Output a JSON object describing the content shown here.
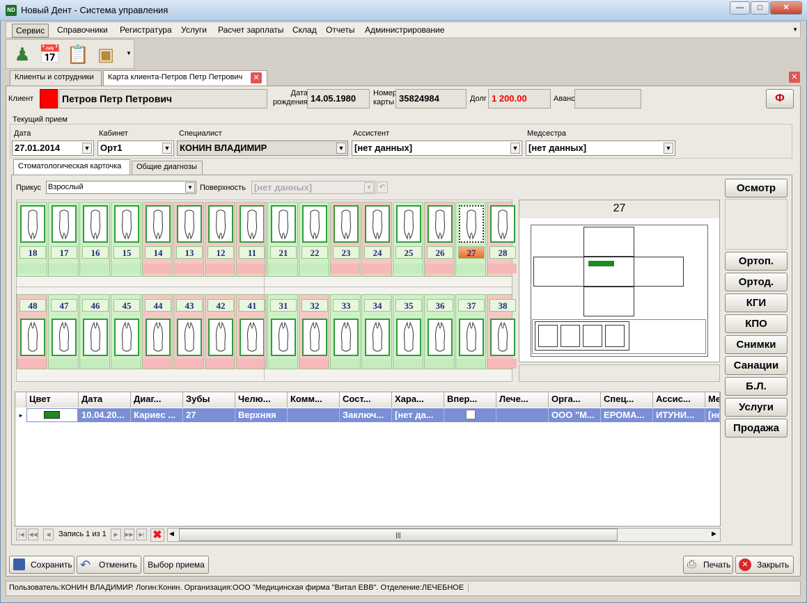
{
  "window": {
    "title": "Новый Дент - Система управления",
    "icon": "ND"
  },
  "menu": [
    "Сервис",
    "Справочники",
    "Регистратура",
    "Услуги",
    "Расчет зарплаты",
    "Склад",
    "Отчеты",
    "Администрирование"
  ],
  "toolbar": [
    "user-icon",
    "calendar-icon",
    "clipboard-icon",
    "box-icon"
  ],
  "tabs": [
    "Клиенты и сотрудники",
    "Карта клиента-Петров Петр Петрович"
  ],
  "client": {
    "label": "Клиент",
    "name": "Петров Петр Петрович",
    "dob_label": "Дата рождения",
    "dob": "14.05.1980",
    "card_label": "Номер карты",
    "card": "35824984",
    "debt_label": "Долг",
    "debt": "1 200.00",
    "advance_label": "Аванс",
    "advance": "",
    "f_button": "Ф"
  },
  "visit": {
    "section": "Текущий прием",
    "date_label": "Дата",
    "date": "27.01.2014",
    "cabinet_label": "Кабинет",
    "cabinet": "Орт1",
    "specialist_label": "Специалист",
    "specialist": "КОНИН ВЛАДИМИР",
    "assistant_label": "Ассистент",
    "assistant": "[нет данных]",
    "nurse_label": "Медсестра",
    "nurse": "[нет данных]"
  },
  "subtabs": [
    "Стоматологическая карточка",
    "Общие диагнозы"
  ],
  "bite": {
    "label": "Прикус",
    "value": "Взрослый",
    "surface_label": "Поверхность",
    "surface_value": "[нет данных]"
  },
  "teeth_upper": [
    {
      "n": "18",
      "c": "g"
    },
    {
      "n": "17",
      "c": "g"
    },
    {
      "n": "16",
      "c": "g"
    },
    {
      "n": "15",
      "c": "g"
    },
    {
      "n": "14",
      "c": "r"
    },
    {
      "n": "13",
      "c": "r"
    },
    {
      "n": "12",
      "c": "r"
    },
    {
      "n": "11",
      "c": "r"
    },
    {
      "n": "21",
      "c": "g"
    },
    {
      "n": "22",
      "c": "g"
    },
    {
      "n": "23",
      "c": "r"
    },
    {
      "n": "24",
      "c": "r"
    },
    {
      "n": "25",
      "c": "g"
    },
    {
      "n": "26",
      "c": "r"
    },
    {
      "n": "27",
      "c": "s"
    },
    {
      "n": "28",
      "c": "r"
    }
  ],
  "teeth_lower": [
    {
      "n": "48",
      "c": "r"
    },
    {
      "n": "47",
      "c": "g"
    },
    {
      "n": "46",
      "c": "g"
    },
    {
      "n": "45",
      "c": "g"
    },
    {
      "n": "44",
      "c": "r"
    },
    {
      "n": "43",
      "c": "r"
    },
    {
      "n": "42",
      "c": "r"
    },
    {
      "n": "41",
      "c": "r"
    },
    {
      "n": "31",
      "c": "g"
    },
    {
      "n": "32",
      "c": "r"
    },
    {
      "n": "33",
      "c": "g"
    },
    {
      "n": "34",
      "c": "g"
    },
    {
      "n": "35",
      "c": "g"
    },
    {
      "n": "36",
      "c": "g"
    },
    {
      "n": "37",
      "c": "g"
    },
    {
      "n": "38",
      "c": "r"
    }
  ],
  "selected_tooth": "27",
  "side_buttons": [
    "Осмотр",
    "Ортоп.",
    "Ортод.",
    "КГИ",
    "КПО",
    "Снимки",
    "Санации",
    "Б.Л.",
    "Услуги",
    "Продажа"
  ],
  "grid": {
    "columns": [
      "Цвет",
      "Дата",
      "Диаг...",
      "Зубы",
      "Челю...",
      "Комм...",
      "Сост...",
      "Хара...",
      "Впер...",
      "Лече...",
      "Орга...",
      "Спец...",
      "Ассис...",
      "Ме"
    ],
    "row": [
      "",
      "10.04.20...",
      "Кариес ...",
      "27",
      "Верхняя",
      "",
      "Заключ...",
      "[нет да...",
      "",
      "",
      "ООО \"М...",
      "ЕРОМА...",
      "ИТУНИ...",
      "[не"
    ],
    "row_color": "#1c8a1c"
  },
  "pager": {
    "text": "Запись 1 из 1"
  },
  "bottom": {
    "save": "Сохранить",
    "cancel": "Отменить",
    "select": "Выбор приема",
    "print": "Печать",
    "close": "Закрыть"
  },
  "status": "Пользователь:КОНИН ВЛАДИМИР. Логин:Конин. Организация:ООО \"Медицинская фирма \"Витал ЕВВ\". Отделение:ЛЕЧЕБНОЕ"
}
